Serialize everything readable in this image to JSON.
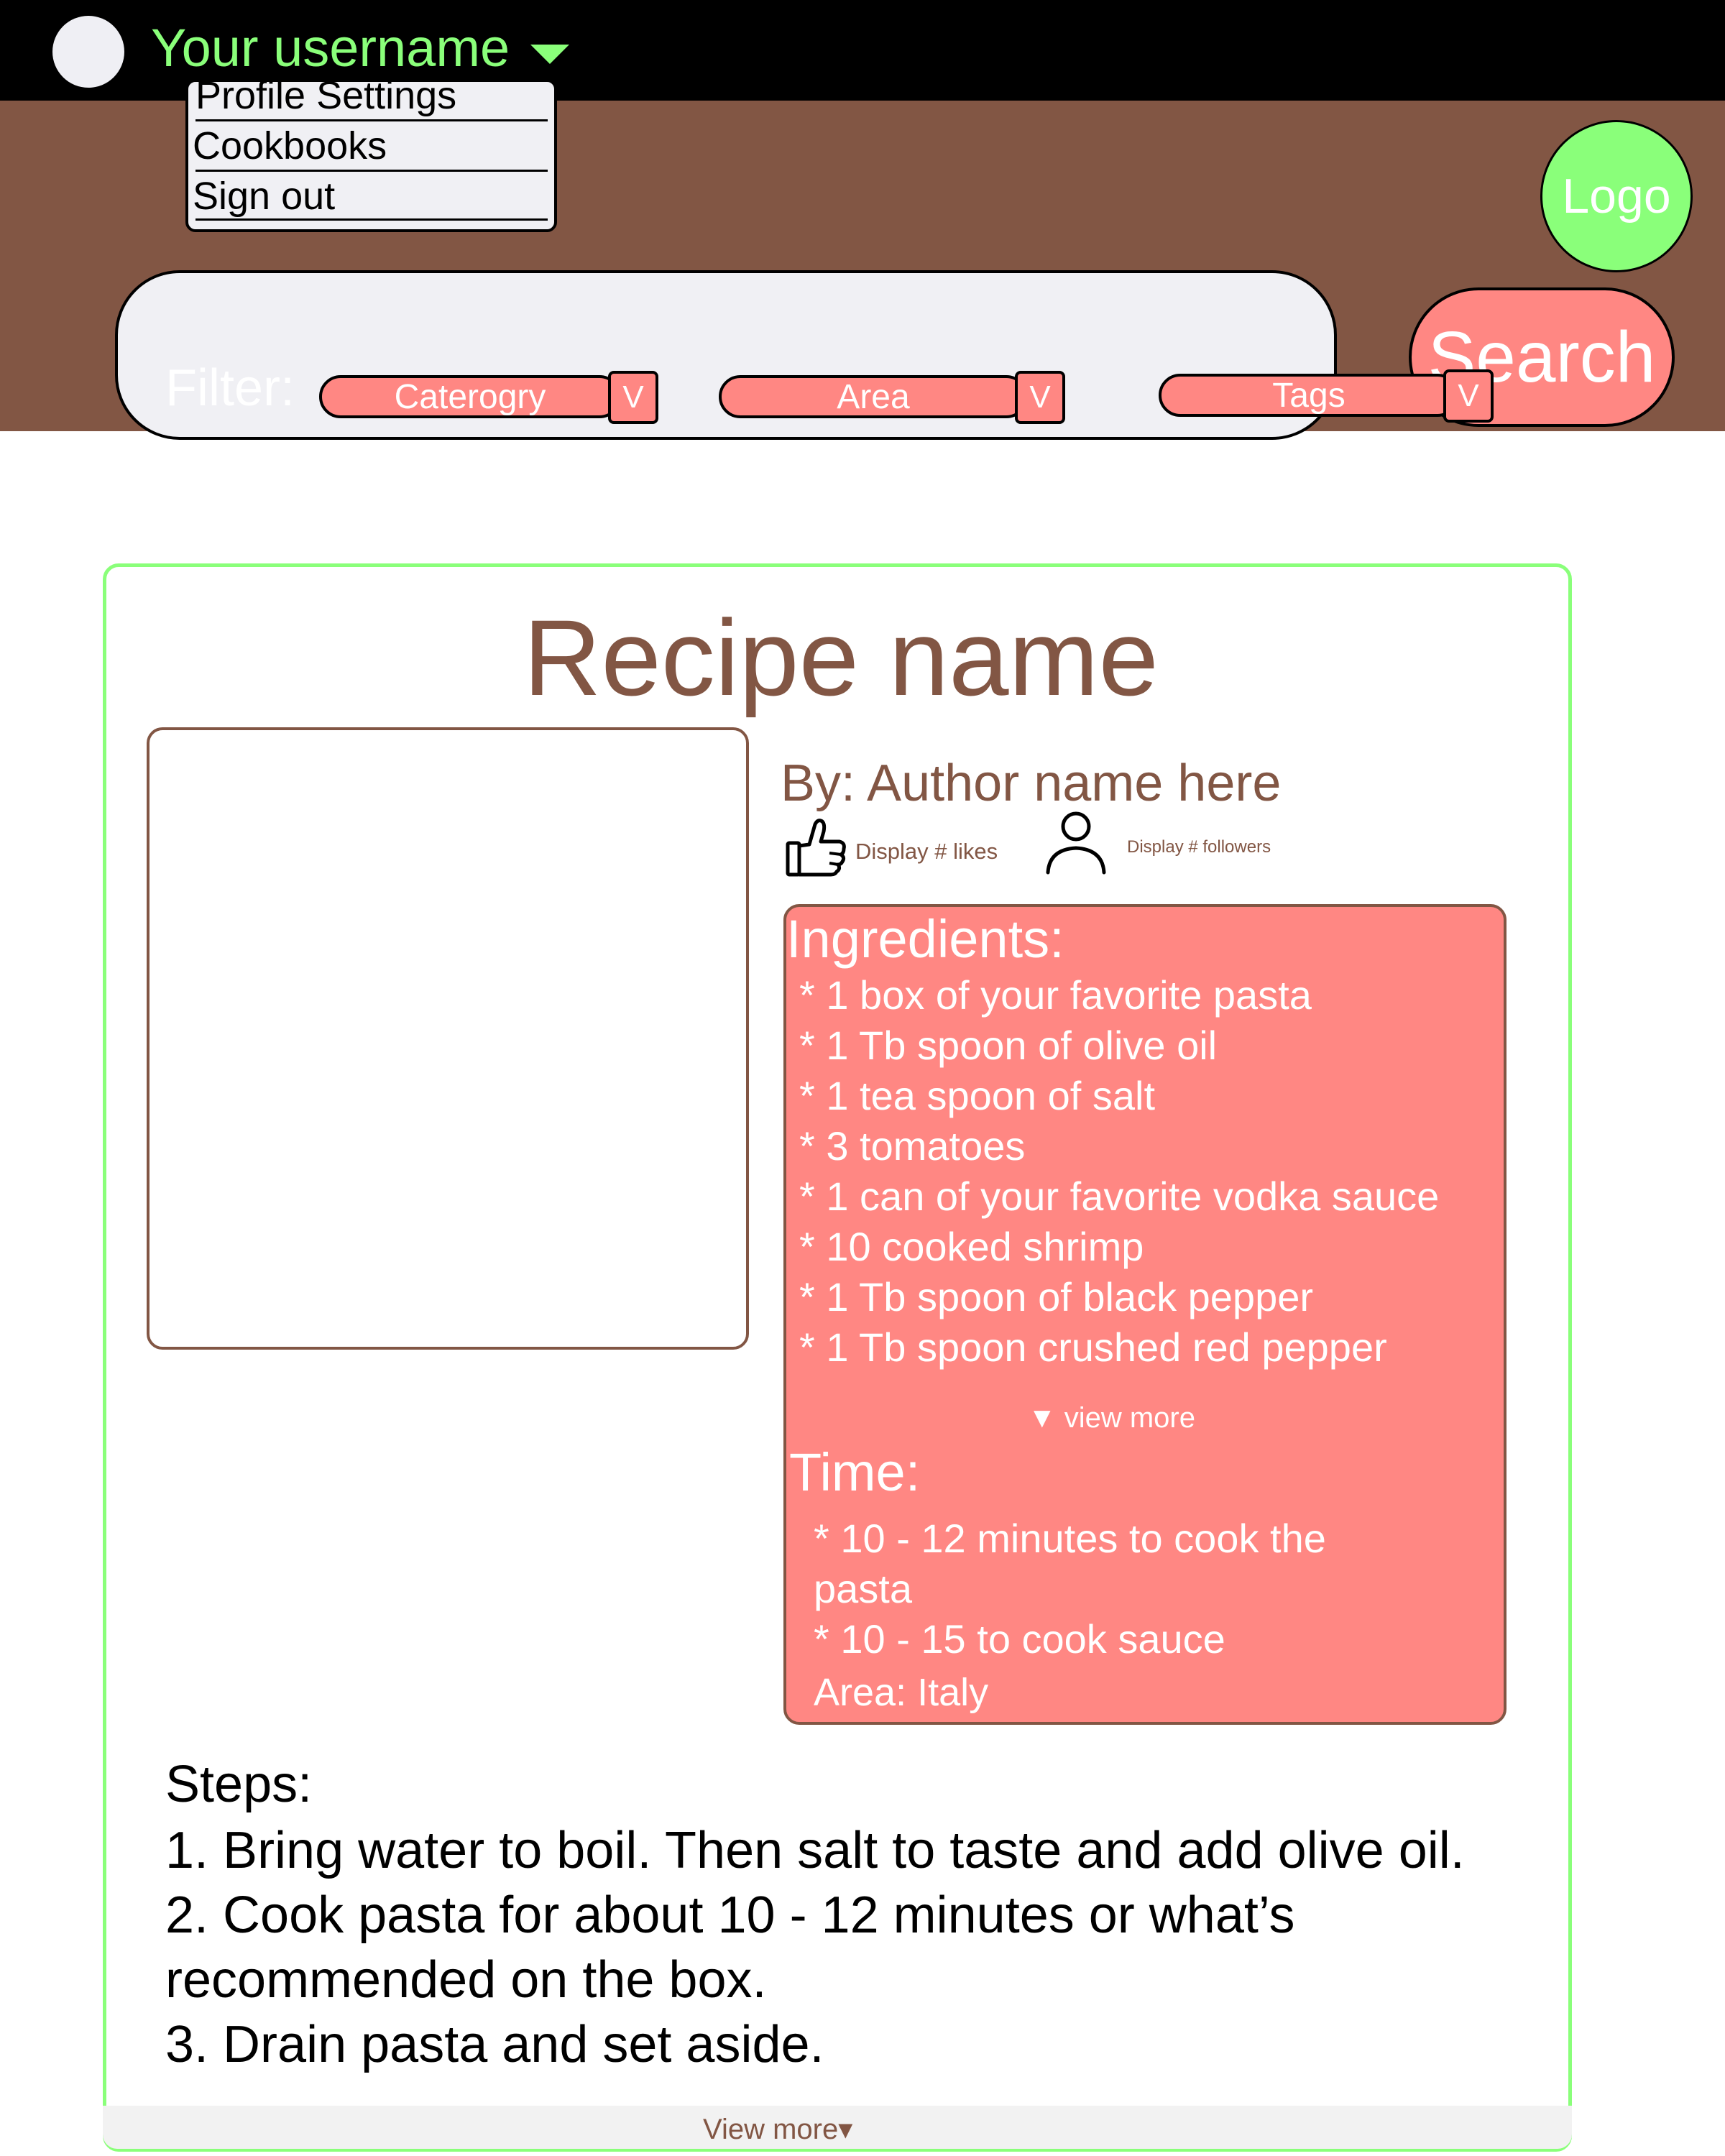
{
  "topbar": {
    "username": "Your username",
    "user_menu": [
      "Profile Settings",
      "Cookbooks",
      "Sign out"
    ],
    "logo_text": "Logo"
  },
  "search": {
    "placeholder": "",
    "button_label": "Search"
  },
  "filters": {
    "label": "Filter:",
    "items": [
      {
        "label": "Caterogry",
        "toggle": "V"
      },
      {
        "label": "Area",
        "toggle": "V"
      },
      {
        "label": "Tags",
        "toggle": "V"
      }
    ]
  },
  "recipe": {
    "title": "Recipe name",
    "author": "By: Author name here",
    "likes_text": "Display # likes",
    "followers_text": "Display # followers",
    "ingredients_heading": "Ingredients:",
    "ingredients": [
      "* 1 box of your favorite pasta",
      "* 1 Tb spoon of olive oil",
      "* 1 tea spoon of salt",
      "* 3 tomatoes",
      "* 1 can of your favorite vodka sauce",
      "* 10 cooked shrimp",
      "* 1 Tb spoon of black pepper",
      "* 1 Tb spoon crushed red pepper"
    ],
    "ingredients_view_more": "▼ view more",
    "time_heading": "Time:",
    "time_items": [
      "* 10 - 12 minutes to cook the pasta",
      "* 10 - 15 to cook sauce"
    ],
    "area": "Area: Italy",
    "steps_heading": "Steps:",
    "steps": [
      "1. Bring water to boil. Then salt to taste and add olive oil.",
      "2. Cook pasta for about 10 - 12 minutes or what’s recommended on the box.",
      "3. Drain pasta and set aside."
    ],
    "steps_view_more": "View more▾"
  },
  "colors": {
    "topbar": "#000000",
    "header": "#825644",
    "accent_green": "#8aff7a",
    "salmon": "#ff8783",
    "brown_text": "#825644"
  },
  "icons": [
    "thumbs-up-icon",
    "person-icon",
    "chevron-down-icon"
  ]
}
